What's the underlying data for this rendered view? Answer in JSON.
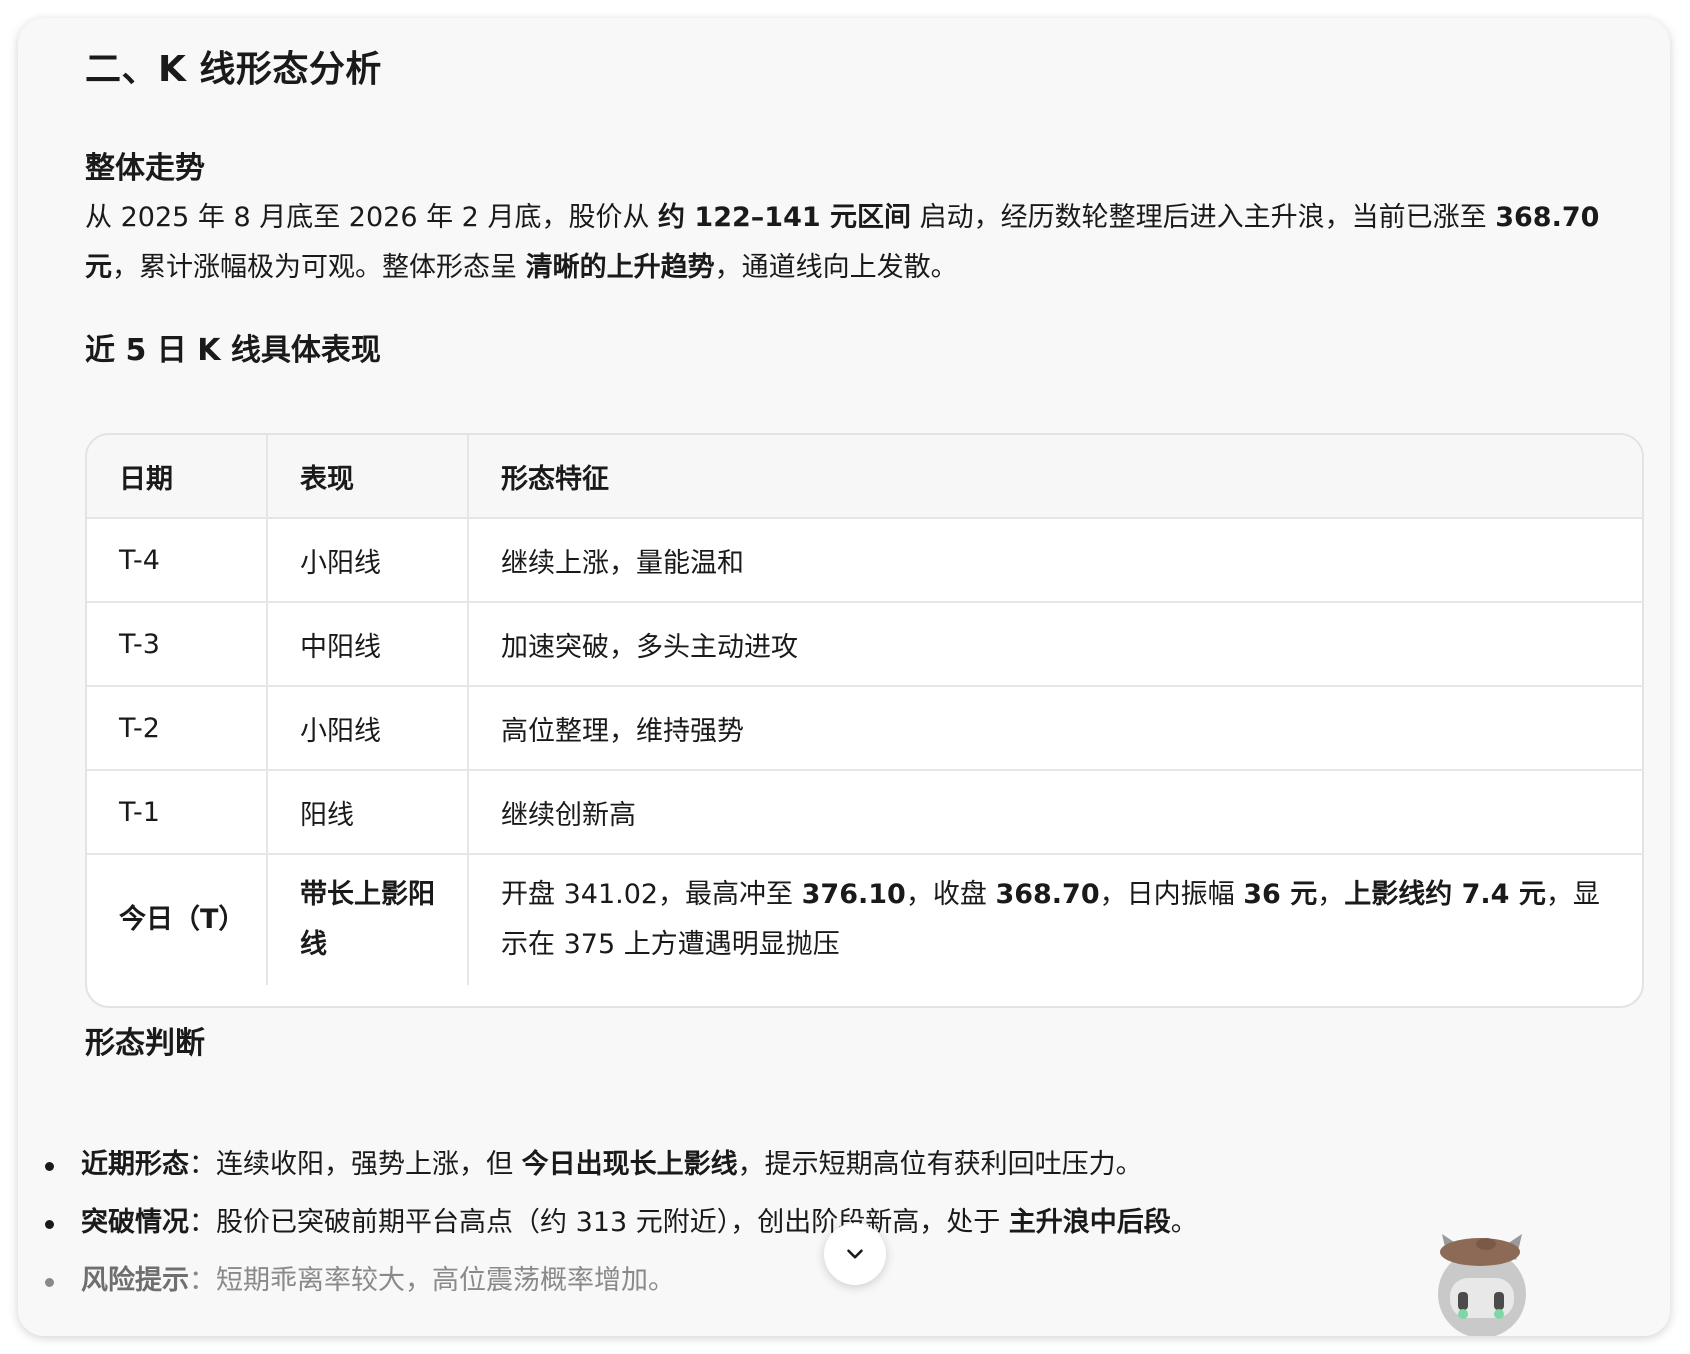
{
  "section_title": "二、K 线形态分析",
  "trend": {
    "heading": "整体走势",
    "paragraph": [
      {
        "text": "从 2025 年 8 月底至 2026 年 2 月底，股价从 ",
        "bold": false
      },
      {
        "text": "约 122–141 元区间",
        "bold": true
      },
      {
        "text": " 启动，经历数轮整理后进入主升浪，当前已涨至 ",
        "bold": false
      },
      {
        "text": "368.70 元",
        "bold": true
      },
      {
        "text": "，累计涨幅极为可观。整体形态呈 ",
        "bold": false
      },
      {
        "text": "清晰的上升趋势",
        "bold": true
      },
      {
        "text": "，通道线向上发散。",
        "bold": false
      }
    ]
  },
  "recent": {
    "heading": "近 5 日 K 线具体表现",
    "columns": [
      "日期",
      "表现",
      "形态特征"
    ],
    "rows": [
      {
        "date": "T-4",
        "perf": "小阳线",
        "feature": [
          {
            "text": "继续上涨，量能温和",
            "bold": false
          }
        ]
      },
      {
        "date": "T-3",
        "perf": "中阳线",
        "feature": [
          {
            "text": "加速突破，多头主动进攻",
            "bold": false
          }
        ]
      },
      {
        "date": "T-2",
        "perf": "小阳线",
        "feature": [
          {
            "text": "高位整理，维持强势",
            "bold": false
          }
        ]
      },
      {
        "date": "T-1",
        "perf": "阳线",
        "feature": [
          {
            "text": "继续创新高",
            "bold": false
          }
        ]
      },
      {
        "date": "今日（T）",
        "perf": "带长上影阳线",
        "highlight": true,
        "feature": [
          {
            "text": "开盘 341.02，最高冲至 ",
            "bold": false
          },
          {
            "text": "376.10",
            "bold": true
          },
          {
            "text": "，收盘 ",
            "bold": false
          },
          {
            "text": "368.70",
            "bold": true
          },
          {
            "text": "，日内振幅 ",
            "bold": false
          },
          {
            "text": "36 元",
            "bold": true
          },
          {
            "text": "，",
            "bold": false
          },
          {
            "text": "上影线约 7.4 元",
            "bold": true
          },
          {
            "text": "，显示在 375 上方遭遇明显抛压",
            "bold": false
          }
        ]
      }
    ]
  },
  "judgment": {
    "heading": "形态判断",
    "items": [
      {
        "label": "近期形态",
        "parts": [
          {
            "text": "：连续收阳，强势上涨，但 ",
            "bold": false
          },
          {
            "text": "今日出现长上影线",
            "bold": true
          },
          {
            "text": "，提示短期高位有获利回吐压力。",
            "bold": false
          }
        ]
      },
      {
        "label": "突破情况",
        "parts": [
          {
            "text": "：股价已突破前期平台高点（约 313 元附近），创出阶段新高，处于 ",
            "bold": false
          },
          {
            "text": "主升浪中后段",
            "bold": true
          },
          {
            "text": "。",
            "bold": false
          }
        ]
      },
      {
        "label": "风险提示",
        "faded": true,
        "parts": [
          {
            "text": "：短期乖离率较大，高位震荡概率增加。",
            "bold": false
          }
        ]
      }
    ]
  },
  "scroll_button": {
    "icon": "chevron-down-icon"
  },
  "mascot": {
    "icon": "robot-cat-mascot-icon"
  },
  "colors": {
    "card_bg": "#f8f8f8",
    "text": "#1a1a1a",
    "border": "#e3e3e3",
    "faded_text": "#8a8a8a"
  }
}
